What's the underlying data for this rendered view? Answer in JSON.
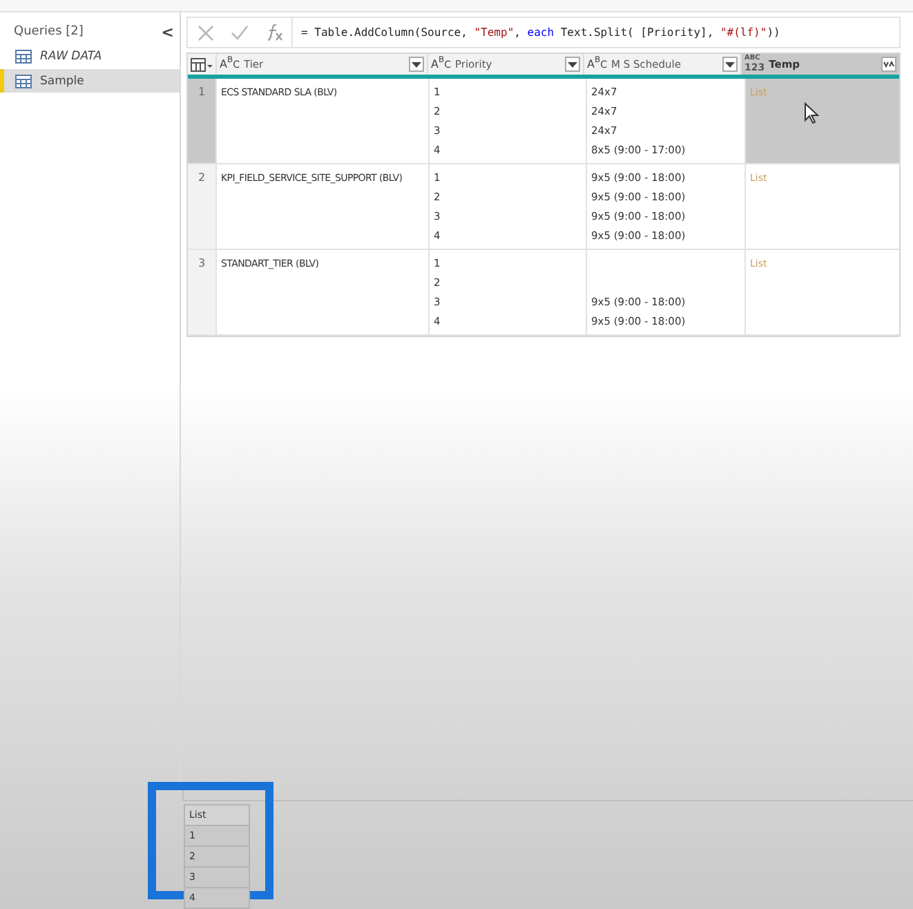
{
  "queries": {
    "title": "Queries [2]",
    "collapse": "<",
    "items": [
      {
        "label": "RAW DATA",
        "selected": false
      },
      {
        "label": "Sample",
        "selected": true
      }
    ]
  },
  "formula_bar": {
    "segments": [
      {
        "text": "= Table.AddColumn(Source, ",
        "kind": "plain"
      },
      {
        "text": "\"Temp\"",
        "kind": "string"
      },
      {
        "text": ", ",
        "kind": "plain"
      },
      {
        "text": "each",
        "kind": "keyword"
      },
      {
        "text": " Text.Split( [Priority], ",
        "kind": "plain"
      },
      {
        "text": "\"#(lf)\"",
        "kind": "string"
      },
      {
        "text": "))",
        "kind": "plain"
      }
    ]
  },
  "table": {
    "columns": [
      {
        "name": "Tier",
        "kind": "text",
        "type_label": "ABC",
        "selected": false
      },
      {
        "name": "Priority",
        "kind": "text",
        "type_label": "ABC",
        "selected": false
      },
      {
        "name": "M S Schedule",
        "kind": "text",
        "type_label": "ABC",
        "selected": false
      },
      {
        "name": "Temp",
        "kind": "any",
        "type_label": "ABC 123",
        "selected": true
      }
    ],
    "rows": [
      {
        "number": "1",
        "selected": true,
        "tier": "ECS STANDARD SLA (BLV)",
        "temp": "List",
        "lines": [
          {
            "priority": "1",
            "schedule": "24x7"
          },
          {
            "priority": "2",
            "schedule": "24x7"
          },
          {
            "priority": "3",
            "schedule": "24x7"
          },
          {
            "priority": "4",
            "schedule": "8x5 (9:00 - 17:00)"
          }
        ]
      },
      {
        "number": "2",
        "selected": false,
        "tier": "KPI_FIELD_SERVICE_SITE_SUPPORT (BLV)",
        "temp": "List",
        "lines": [
          {
            "priority": "1",
            "schedule": "9x5 (9:00 - 18:00)"
          },
          {
            "priority": "2",
            "schedule": "9x5 (9:00 - 18:00)"
          },
          {
            "priority": "3",
            "schedule": "9x5 (9:00 - 18:00)"
          },
          {
            "priority": "4",
            "schedule": "9x5 (9:00 - 18:00)"
          }
        ]
      },
      {
        "number": "3",
        "selected": false,
        "tier": "STANDART_TIER (BLV)",
        "temp": "List",
        "lines": [
          {
            "priority": "1"
          },
          {
            "priority": "2"
          },
          {
            "priority": "3",
            "schedule": "9x5 (9:00 - 18:00)"
          },
          {
            "priority": "4",
            "schedule": "9x5 (9:00 - 18:00)"
          }
        ]
      }
    ]
  },
  "preview": {
    "header": "List",
    "values": [
      "1",
      "2",
      "3",
      "4"
    ],
    "highlighted": true
  }
}
